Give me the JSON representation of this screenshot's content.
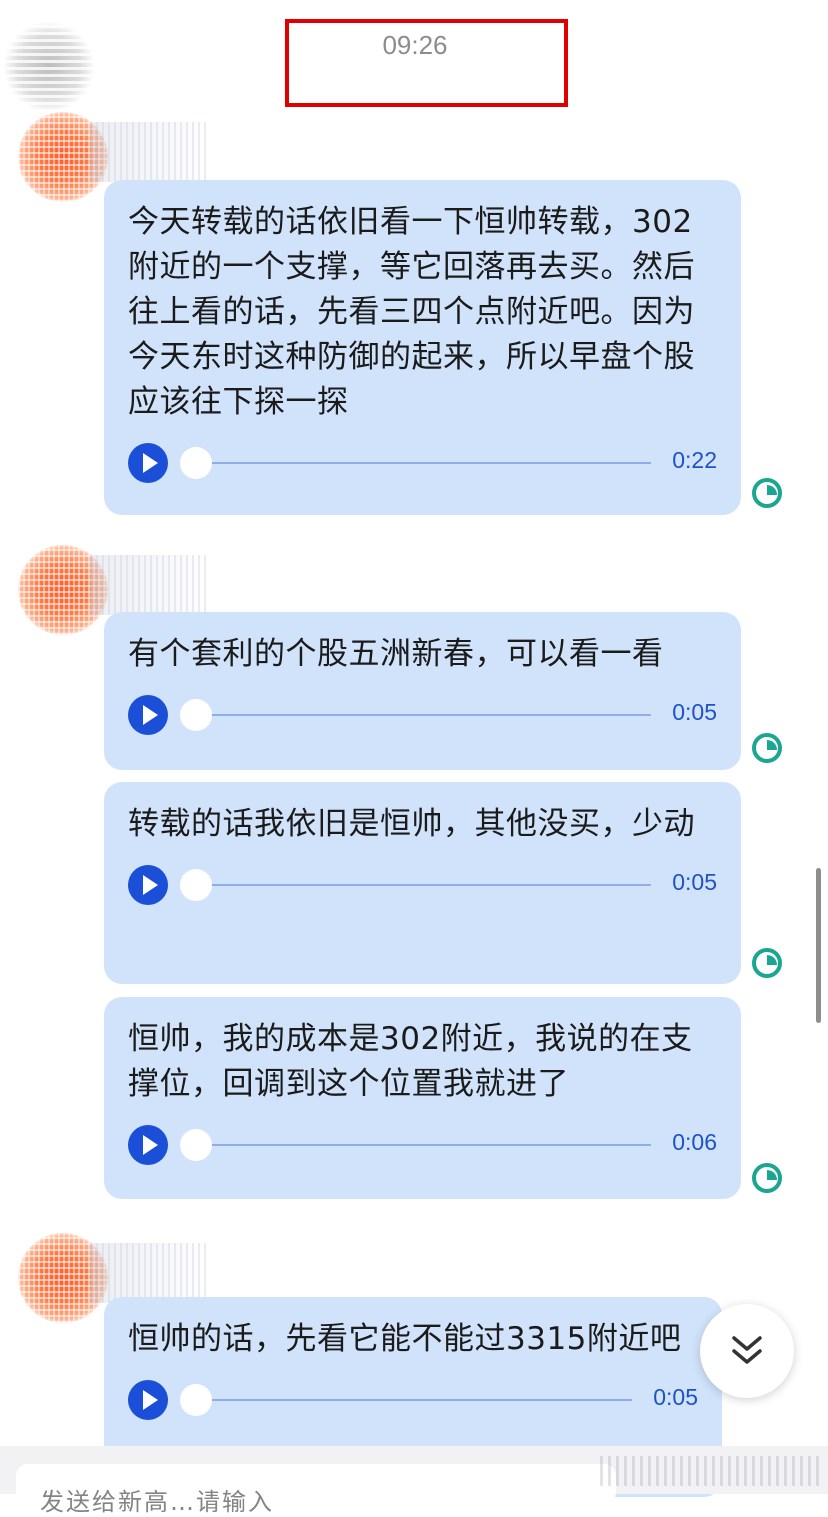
{
  "header": {
    "time": "09:26"
  },
  "messages": [
    {
      "text": "今天转载的话依旧看一下恒帅转载，302附近的一个支撑，等它回落再去买。然后往上看的话，先看三四个点附近吧。因为今天东时这种防御的起来，所以早盘个股应该往下探一探",
      "duration": "0:22"
    },
    {
      "text": "有个套利的个股五洲新春，可以看一看",
      "duration": "0:05"
    },
    {
      "text": "转载的话我依旧是恒帅，其他没买，少动",
      "duration": "0:05"
    },
    {
      "text": "恒帅，我的成本是302附近，我说的在支撑位，回调到这个位置我就进了",
      "duration": "0:06"
    },
    {
      "text": "恒帅的话，先看它能不能过3315附近吧",
      "duration": "0:05"
    }
  ],
  "input": {
    "placeholder": "发送给新高…请输入"
  },
  "colors": {
    "bubble": "#d1e3fb",
    "play": "#1b4fd8",
    "status": "#1aa690",
    "highlight": "#e00000"
  }
}
